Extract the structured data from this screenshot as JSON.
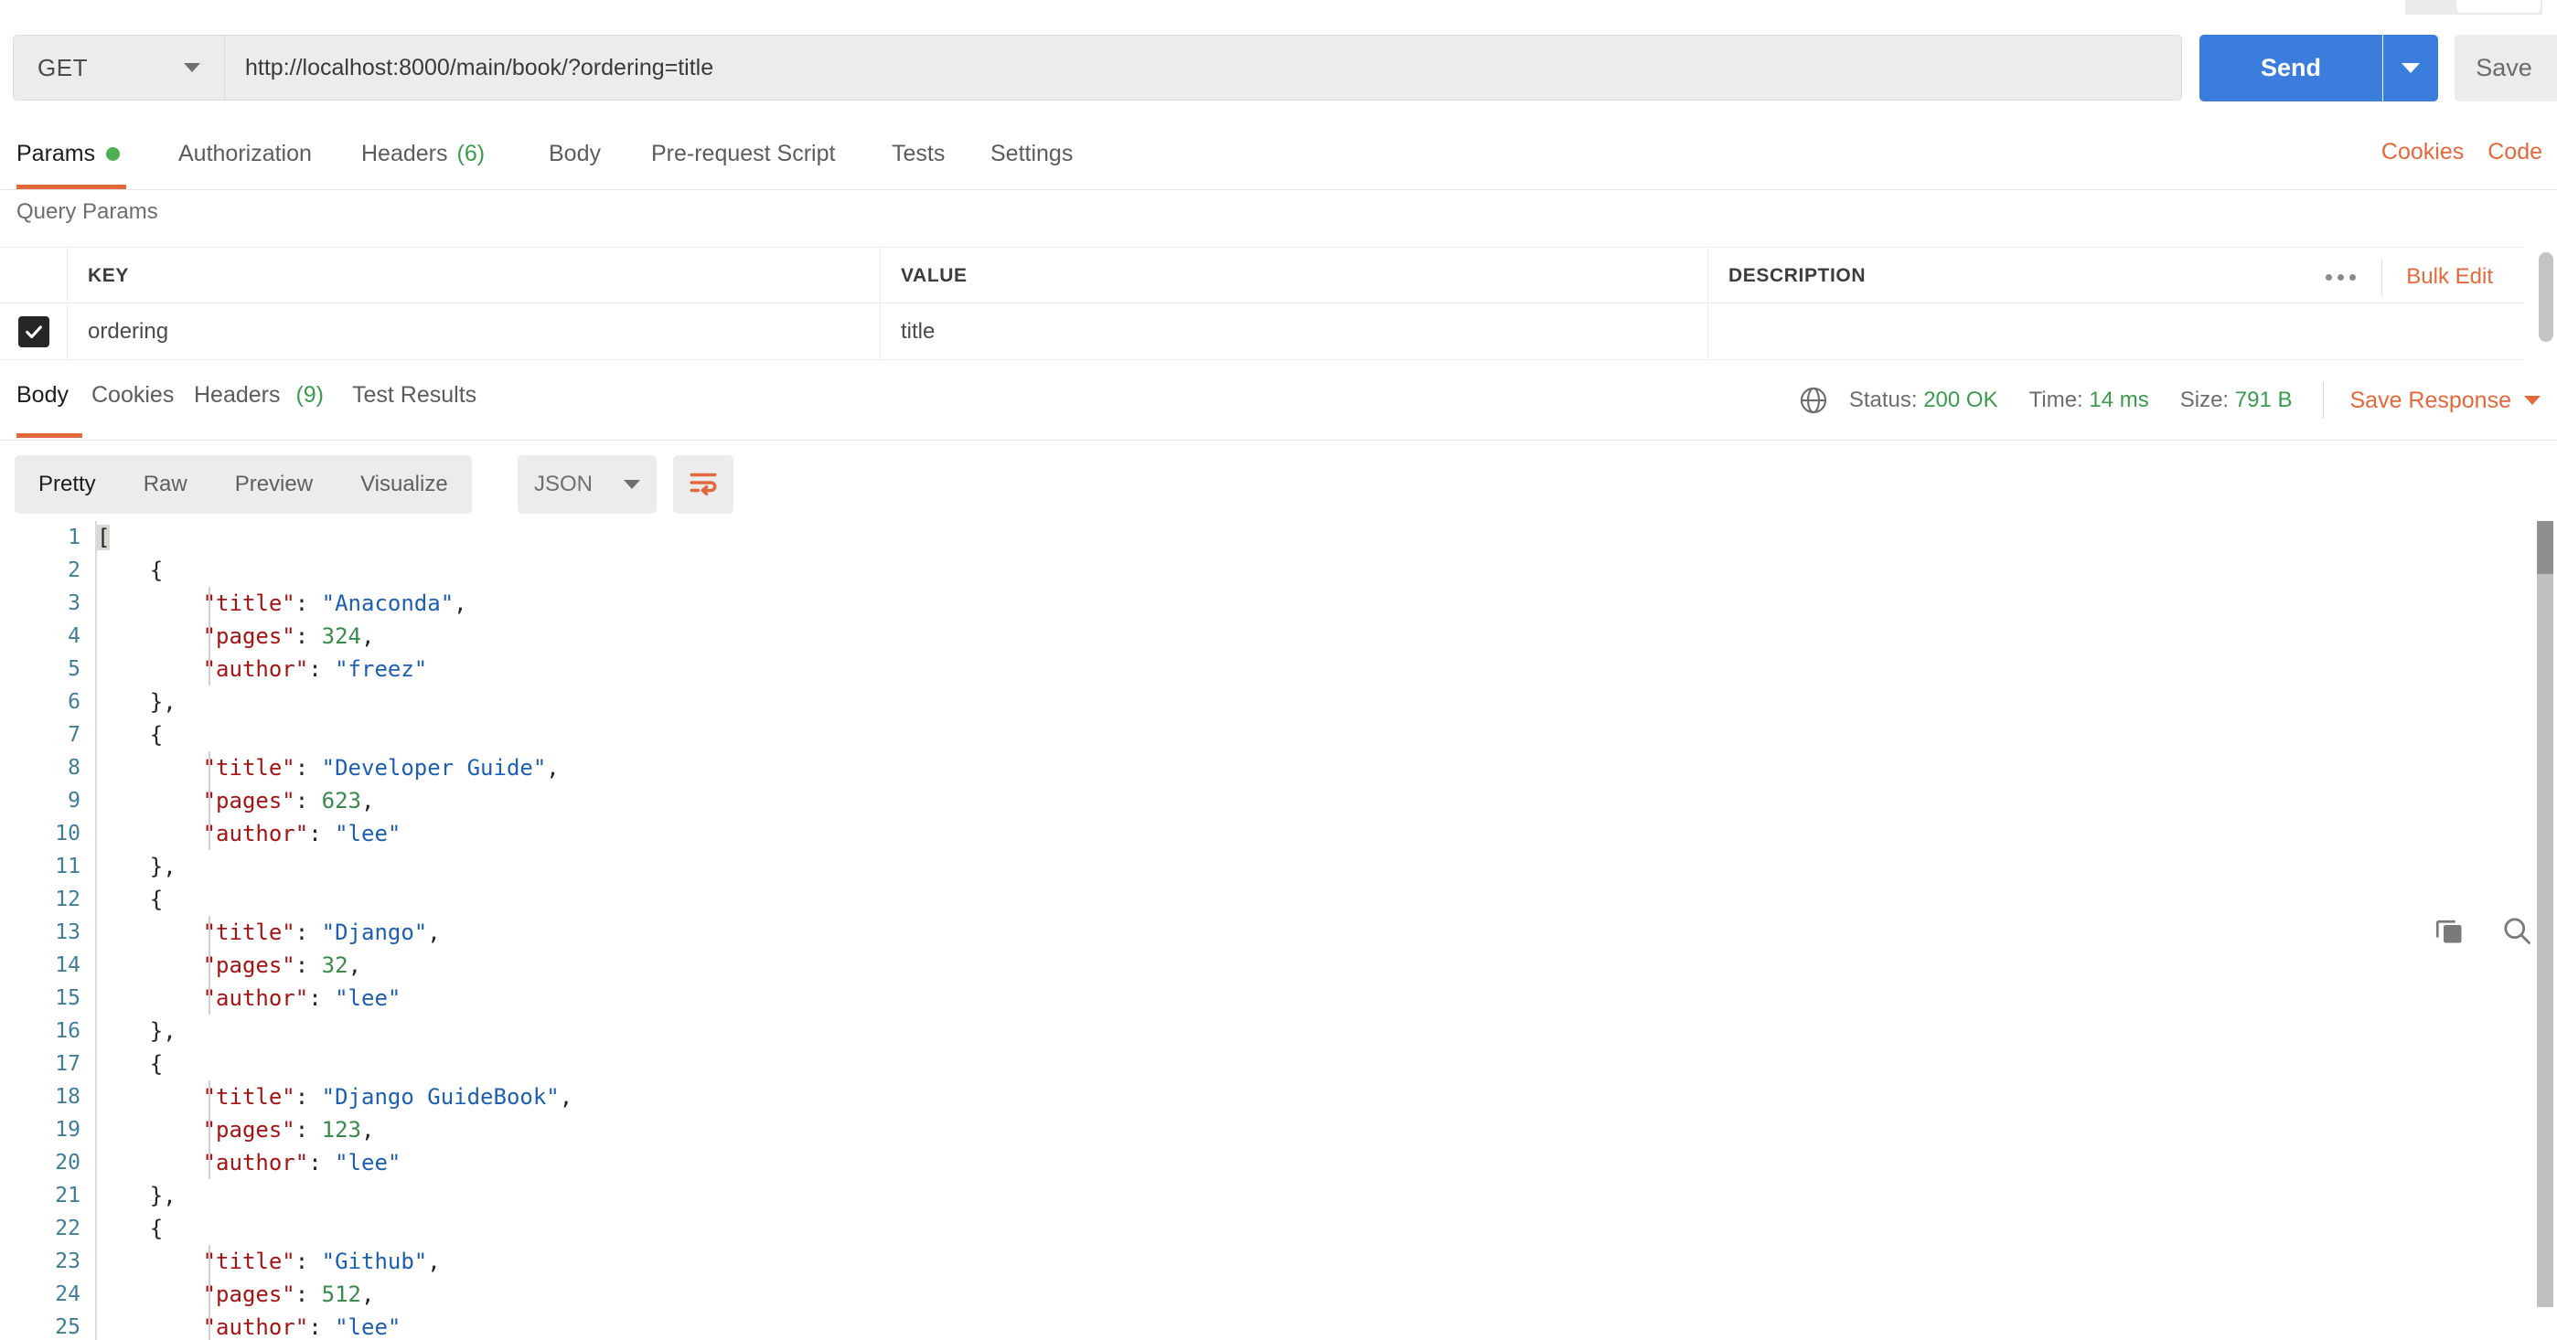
{
  "request": {
    "method": "GET",
    "url": "http://localhost:8000/main/book/?ordering=title",
    "send_label": "Send",
    "save_label": "Save"
  },
  "request_tabs": [
    {
      "label": "Params",
      "dot": true,
      "active": true
    },
    {
      "label": "Authorization",
      "active": false
    },
    {
      "label": "Headers",
      "count": "(6)",
      "active": false
    },
    {
      "label": "Body",
      "active": false
    },
    {
      "label": "Pre-request Script",
      "active": false
    },
    {
      "label": "Tests",
      "active": false
    },
    {
      "label": "Settings",
      "active": false
    }
  ],
  "header_links": [
    {
      "label": "Cookies"
    },
    {
      "label": "Code"
    }
  ],
  "query_params": {
    "title": "Query Params",
    "columns": [
      "KEY",
      "VALUE",
      "DESCRIPTION"
    ],
    "bulk_edit_label": "Bulk Edit",
    "rows": [
      {
        "checked": true,
        "key": "ordering",
        "value": "title",
        "description": ""
      }
    ]
  },
  "response_tabs": [
    {
      "label": "Body",
      "active": true
    },
    {
      "label": "Cookies",
      "active": false
    },
    {
      "label": "Headers",
      "count": "(9)",
      "active": false
    },
    {
      "label": "Test Results",
      "active": false
    }
  ],
  "response_meta": {
    "status_label": "Status:",
    "status_value": "200 OK",
    "time_label": "Time:",
    "time_value": "14 ms",
    "size_label": "Size:",
    "size_value": "791 B",
    "save_response_label": "Save Response"
  },
  "body_toolbar": {
    "views": [
      {
        "label": "Pretty",
        "active": true
      },
      {
        "label": "Raw",
        "active": false
      },
      {
        "label": "Preview",
        "active": false
      },
      {
        "label": "Visualize",
        "active": false
      }
    ],
    "format": "JSON"
  },
  "response_body": {
    "language": "json",
    "lines": [
      {
        "n": 1,
        "indent": 0,
        "tokens": [
          {
            "t": "p",
            "v": "[",
            "sel": true
          }
        ]
      },
      {
        "n": 2,
        "indent": 1,
        "tokens": [
          {
            "t": "p",
            "v": "{"
          }
        ]
      },
      {
        "n": 3,
        "indent": 2,
        "tokens": [
          {
            "t": "key",
            "v": "\"title\""
          },
          {
            "t": "p",
            "v": ": "
          },
          {
            "t": "str",
            "v": "\"Anaconda\""
          },
          {
            "t": "p",
            "v": ","
          }
        ]
      },
      {
        "n": 4,
        "indent": 2,
        "tokens": [
          {
            "t": "key",
            "v": "\"pages\""
          },
          {
            "t": "p",
            "v": ": "
          },
          {
            "t": "num",
            "v": "324"
          },
          {
            "t": "p",
            "v": ","
          }
        ]
      },
      {
        "n": 5,
        "indent": 2,
        "tokens": [
          {
            "t": "key",
            "v": "\"author\""
          },
          {
            "t": "p",
            "v": ": "
          },
          {
            "t": "str",
            "v": "\"freez\""
          }
        ]
      },
      {
        "n": 6,
        "indent": 1,
        "tokens": [
          {
            "t": "p",
            "v": "},"
          }
        ]
      },
      {
        "n": 7,
        "indent": 1,
        "tokens": [
          {
            "t": "p",
            "v": "{"
          }
        ]
      },
      {
        "n": 8,
        "indent": 2,
        "tokens": [
          {
            "t": "key",
            "v": "\"title\""
          },
          {
            "t": "p",
            "v": ": "
          },
          {
            "t": "str",
            "v": "\"Developer Guide\""
          },
          {
            "t": "p",
            "v": ","
          }
        ]
      },
      {
        "n": 9,
        "indent": 2,
        "tokens": [
          {
            "t": "key",
            "v": "\"pages\""
          },
          {
            "t": "p",
            "v": ": "
          },
          {
            "t": "num",
            "v": "623"
          },
          {
            "t": "p",
            "v": ","
          }
        ]
      },
      {
        "n": 10,
        "indent": 2,
        "tokens": [
          {
            "t": "key",
            "v": "\"author\""
          },
          {
            "t": "p",
            "v": ": "
          },
          {
            "t": "str",
            "v": "\"lee\""
          }
        ]
      },
      {
        "n": 11,
        "indent": 1,
        "tokens": [
          {
            "t": "p",
            "v": "},"
          }
        ]
      },
      {
        "n": 12,
        "indent": 1,
        "tokens": [
          {
            "t": "p",
            "v": "{"
          }
        ]
      },
      {
        "n": 13,
        "indent": 2,
        "tokens": [
          {
            "t": "key",
            "v": "\"title\""
          },
          {
            "t": "p",
            "v": ": "
          },
          {
            "t": "str",
            "v": "\"Django\""
          },
          {
            "t": "p",
            "v": ","
          }
        ]
      },
      {
        "n": 14,
        "indent": 2,
        "tokens": [
          {
            "t": "key",
            "v": "\"pages\""
          },
          {
            "t": "p",
            "v": ": "
          },
          {
            "t": "num",
            "v": "32"
          },
          {
            "t": "p",
            "v": ","
          }
        ]
      },
      {
        "n": 15,
        "indent": 2,
        "tokens": [
          {
            "t": "key",
            "v": "\"author\""
          },
          {
            "t": "p",
            "v": ": "
          },
          {
            "t": "str",
            "v": "\"lee\""
          }
        ]
      },
      {
        "n": 16,
        "indent": 1,
        "tokens": [
          {
            "t": "p",
            "v": "},"
          }
        ]
      },
      {
        "n": 17,
        "indent": 1,
        "tokens": [
          {
            "t": "p",
            "v": "{"
          }
        ]
      },
      {
        "n": 18,
        "indent": 2,
        "tokens": [
          {
            "t": "key",
            "v": "\"title\""
          },
          {
            "t": "p",
            "v": ": "
          },
          {
            "t": "str",
            "v": "\"Django GuideBook\""
          },
          {
            "t": "p",
            "v": ","
          }
        ]
      },
      {
        "n": 19,
        "indent": 2,
        "tokens": [
          {
            "t": "key",
            "v": "\"pages\""
          },
          {
            "t": "p",
            "v": ": "
          },
          {
            "t": "num",
            "v": "123"
          },
          {
            "t": "p",
            "v": ","
          }
        ]
      },
      {
        "n": 20,
        "indent": 2,
        "tokens": [
          {
            "t": "key",
            "v": "\"author\""
          },
          {
            "t": "p",
            "v": ": "
          },
          {
            "t": "str",
            "v": "\"lee\""
          }
        ]
      },
      {
        "n": 21,
        "indent": 1,
        "tokens": [
          {
            "t": "p",
            "v": "},"
          }
        ]
      },
      {
        "n": 22,
        "indent": 1,
        "tokens": [
          {
            "t": "p",
            "v": "{"
          }
        ]
      },
      {
        "n": 23,
        "indent": 2,
        "tokens": [
          {
            "t": "key",
            "v": "\"title\""
          },
          {
            "t": "p",
            "v": ": "
          },
          {
            "t": "str",
            "v": "\"Github\""
          },
          {
            "t": "p",
            "v": ","
          }
        ]
      },
      {
        "n": 24,
        "indent": 2,
        "tokens": [
          {
            "t": "key",
            "v": "\"pages\""
          },
          {
            "t": "p",
            "v": ": "
          },
          {
            "t": "num",
            "v": "512"
          },
          {
            "t": "p",
            "v": ","
          }
        ]
      },
      {
        "n": 25,
        "indent": 2,
        "tokens": [
          {
            "t": "key",
            "v": "\"author\""
          },
          {
            "t": "p",
            "v": ": "
          },
          {
            "t": "str",
            "v": "\"lee\""
          }
        ]
      }
    ]
  },
  "colors": {
    "accent_orange": "#e3683c",
    "send_blue": "#3b7ddd",
    "status_green": "#3a9b4e",
    "json_key": "#a31515",
    "json_string": "#1c5fb0",
    "json_number": "#3a8a4e",
    "line_number": "#3f7d99"
  }
}
